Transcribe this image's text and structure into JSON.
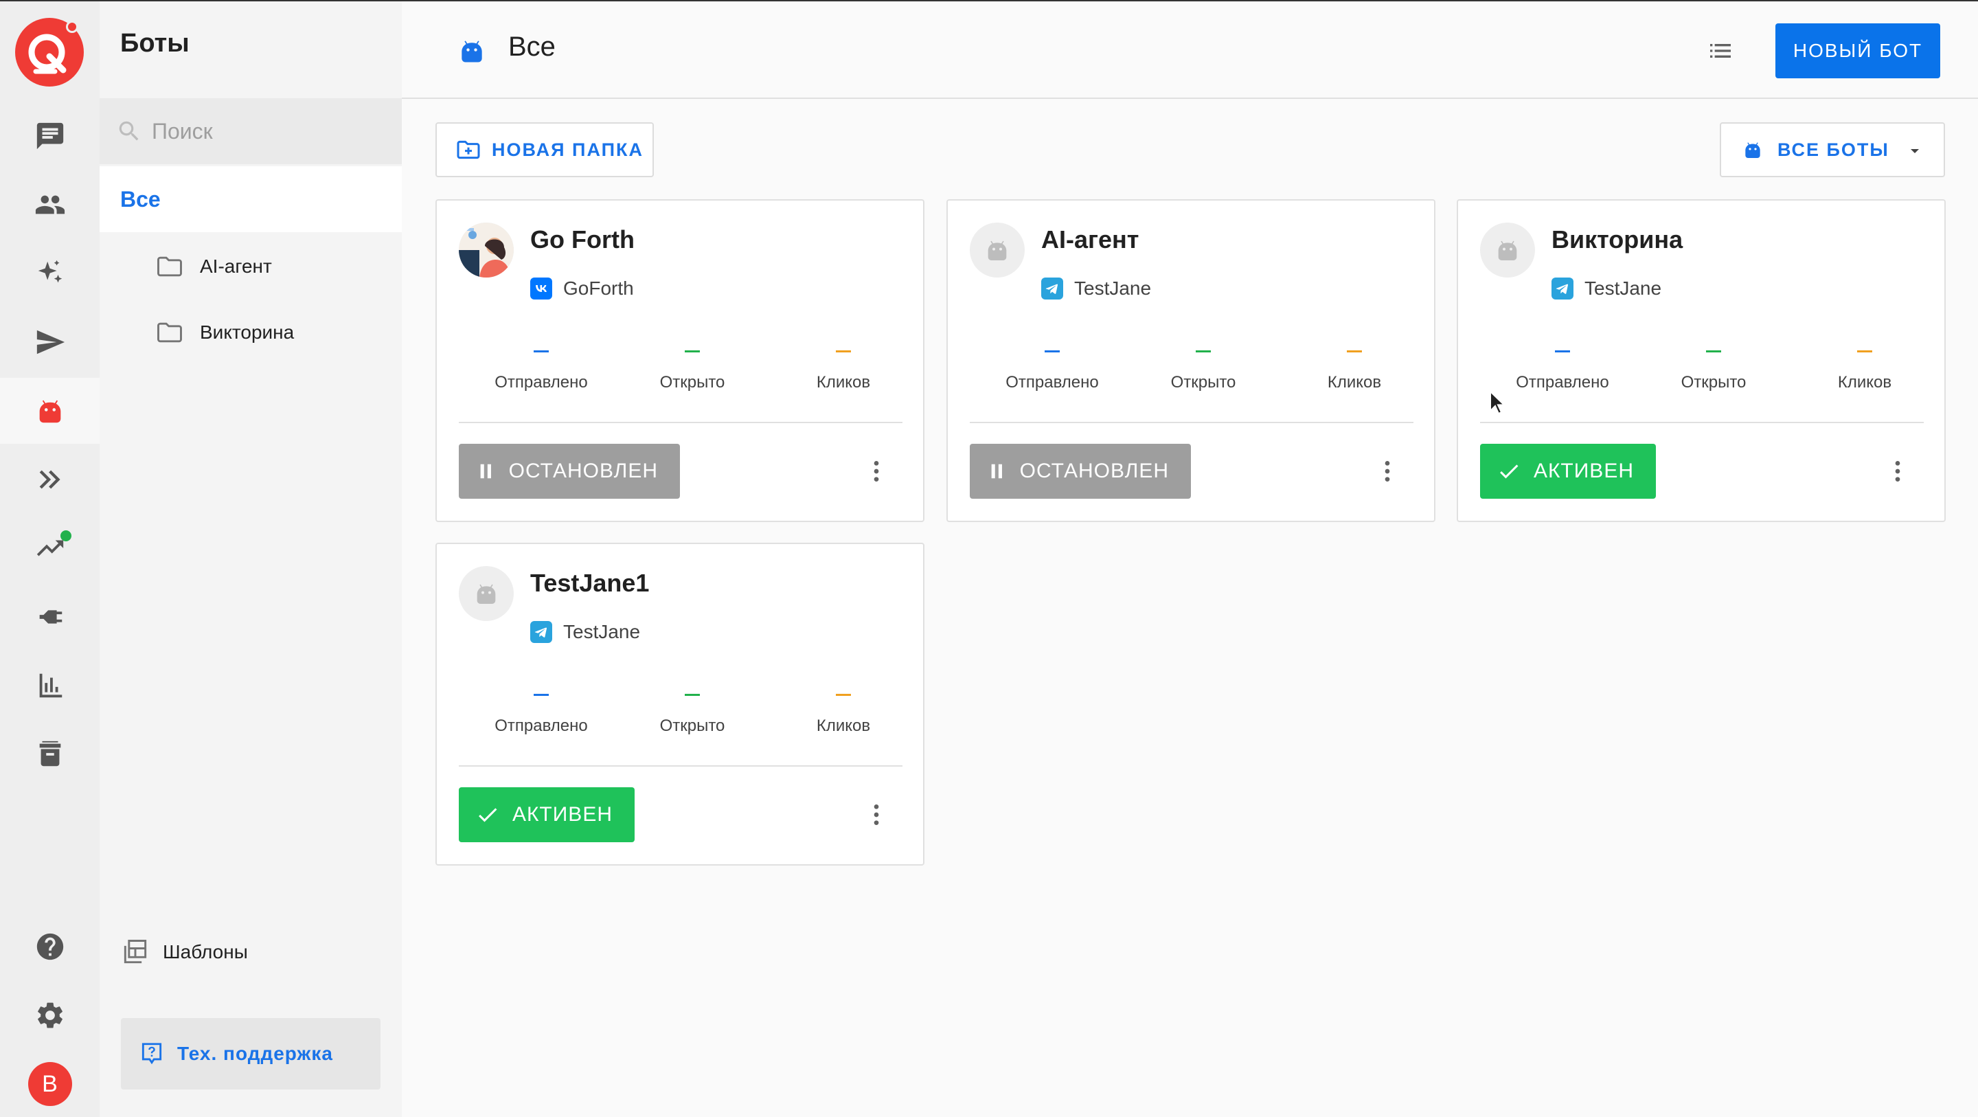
{
  "rail": {
    "items": [
      {
        "icon": "chat-icon"
      },
      {
        "icon": "users-icon"
      },
      {
        "icon": "sparkles-icon"
      },
      {
        "icon": "send-icon"
      },
      {
        "icon": "bot-icon",
        "active": true
      },
      {
        "icon": "double-chevron-icon"
      },
      {
        "icon": "trending-icon",
        "badge": true
      },
      {
        "icon": "plug-icon"
      },
      {
        "icon": "bar-chart-icon"
      },
      {
        "icon": "archive-icon"
      }
    ],
    "bottom": [
      {
        "icon": "help-icon"
      },
      {
        "icon": "settings-icon"
      }
    ],
    "avatar_letter": "B"
  },
  "sidebar": {
    "title": "Боты",
    "search_placeholder": "Поиск",
    "all_label": "Все",
    "folders": [
      "AI-агент",
      "Викторина"
    ],
    "templates_label": "Шаблоны",
    "support_label": "Тех. поддержка"
  },
  "header": {
    "title": "Все",
    "new_bot_label": "НОВЫЙ БОТ"
  },
  "toolbar": {
    "new_folder_label": "НОВАЯ ПАПКА",
    "filter_label": "ВСЕ БОТЫ"
  },
  "stats_labels": {
    "sent": "Отправлено",
    "opened": "Открыто",
    "clicks": "Кликов"
  },
  "bots": [
    {
      "name": "Go Forth",
      "channel": "GoForth",
      "channel_type": "vk",
      "status": "ОСТАНОВЛЕН",
      "state": "stopped"
    },
    {
      "name": "AI-агент",
      "channel": "TestJane",
      "channel_type": "telegram",
      "status": "ОСТАНОВЛЕН",
      "state": "stopped"
    },
    {
      "name": "Викторина",
      "channel": "TestJane",
      "channel_type": "telegram",
      "status": "АКТИВЕН",
      "state": "active"
    },
    {
      "name": "TestJane1",
      "channel": "TestJane",
      "channel_type": "telegram",
      "status": "АКТИВЕН",
      "state": "active"
    }
  ],
  "colors": {
    "accent": "#0a73ea",
    "brand": "#ef3b35",
    "active": "#1fc25a",
    "stopped": "#9e9e9e",
    "sent_dash": "#1a73e8",
    "opened_dash": "#22b14c",
    "clicks_dash": "#f0a020"
  }
}
